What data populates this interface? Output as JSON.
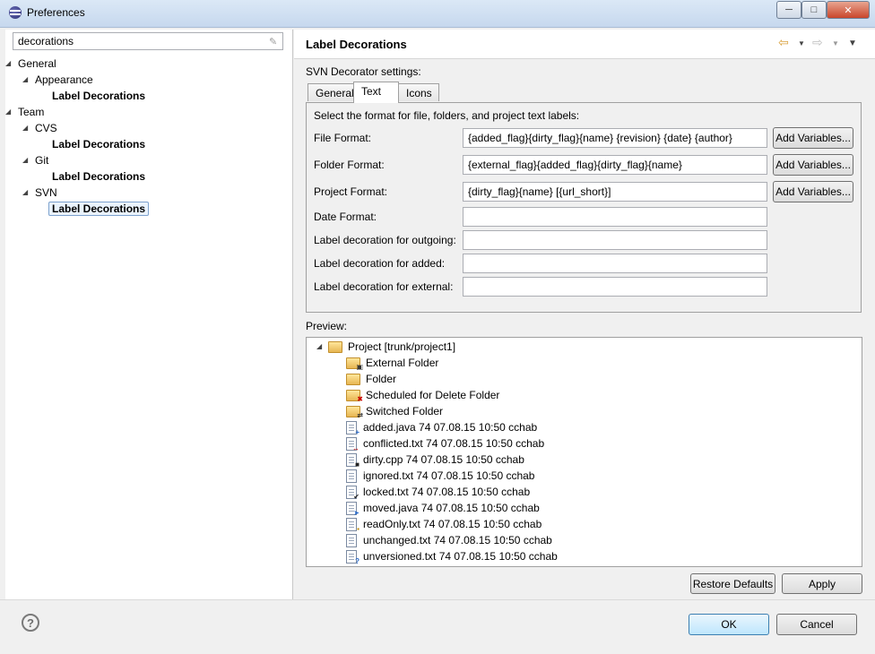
{
  "window": {
    "title": "Preferences",
    "minimize_icon": "minimize-icon",
    "maximize_icon": "maximize-icon",
    "close_icon": "close-icon"
  },
  "filter": {
    "value": "decorations"
  },
  "tree": [
    {
      "label": "General",
      "level": 0,
      "bold": false
    },
    {
      "label": "Appearance",
      "level": 1,
      "bold": false
    },
    {
      "label": "Label Decorations",
      "level": 2,
      "bold": true
    },
    {
      "label": "Team",
      "level": 0,
      "bold": false
    },
    {
      "label": "CVS",
      "level": 1,
      "bold": false
    },
    {
      "label": "Label Decorations",
      "level": 2,
      "bold": true
    },
    {
      "label": "Git",
      "level": 1,
      "bold": false
    },
    {
      "label": "Label Decorations",
      "level": 2,
      "bold": true
    },
    {
      "label": "SVN",
      "level": 1,
      "bold": false
    },
    {
      "label": "Label Decorations",
      "level": 2,
      "bold": true,
      "selected": true
    }
  ],
  "page": {
    "title": "Label Decorations",
    "section": "SVN Decorator settings:",
    "tabs": [
      "General",
      "Text",
      "Icons"
    ],
    "active_tab": "Text",
    "intro": "Select the format for file, folders, and project text labels:",
    "fields": [
      {
        "label": "File Format:",
        "value": "{added_flag}{dirty_flag}{name} {revision}  {date}  {author}",
        "has_button": true
      },
      {
        "label": "Folder Format:",
        "value": "{external_flag}{added_flag}{dirty_flag}{name}",
        "has_button": true
      },
      {
        "label": "Project Format:",
        "value": "{dirty_flag}{name} [{url_short}]",
        "has_button": true
      },
      {
        "label": "Date Format:",
        "value": "",
        "has_button": false
      },
      {
        "label": "Label decoration for outgoing:",
        "value": "",
        "has_button": false
      },
      {
        "label": "Label decoration for added:",
        "value": "",
        "has_button": false
      },
      {
        "label": "Label decoration for external:",
        "value": "",
        "has_button": false
      }
    ],
    "add_variables_label": "Add Variables..."
  },
  "preview": {
    "label": "Preview:",
    "project": "Project [trunk/project1]",
    "items": [
      {
        "label": "External Folder",
        "kind": "folder",
        "overlay": "external"
      },
      {
        "label": "Folder",
        "kind": "folder",
        "overlay": ""
      },
      {
        "label": "Scheduled for Delete Folder",
        "kind": "folder",
        "overlay": "delete"
      },
      {
        "label": "Switched Folder",
        "kind": "folder",
        "overlay": "switched"
      },
      {
        "label": "added.java 74  07.08.15 10:50  cchab",
        "kind": "file",
        "overlay": "added"
      },
      {
        "label": "conflicted.txt 74  07.08.15 10:50  cchab",
        "kind": "file",
        "overlay": "conflicted"
      },
      {
        "label": "dirty.cpp 74  07.08.15 10:50  cchab",
        "kind": "file",
        "overlay": "dirty"
      },
      {
        "label": "ignored.txt 74  07.08.15 10:50  cchab",
        "kind": "file",
        "overlay": ""
      },
      {
        "label": "locked.txt 74  07.08.15 10:50  cchab",
        "kind": "file",
        "overlay": "locked"
      },
      {
        "label": "moved.java 74  07.08.15 10:50  cchab",
        "kind": "file",
        "overlay": "moved"
      },
      {
        "label": "readOnly.txt 74  07.08.15 10:50  cchab",
        "kind": "file",
        "overlay": "readonly"
      },
      {
        "label": "unchanged.txt 74  07.08.15 10:50  cchab",
        "kind": "file",
        "overlay": ""
      },
      {
        "label": "unversioned.txt 74  07.08.15 10:50  cchab",
        "kind": "file",
        "overlay": "unversioned"
      }
    ]
  },
  "buttons": {
    "restore_defaults": "Restore Defaults",
    "apply": "Apply",
    "ok": "OK",
    "cancel": "Cancel"
  },
  "icons": {
    "help": "help-icon"
  }
}
